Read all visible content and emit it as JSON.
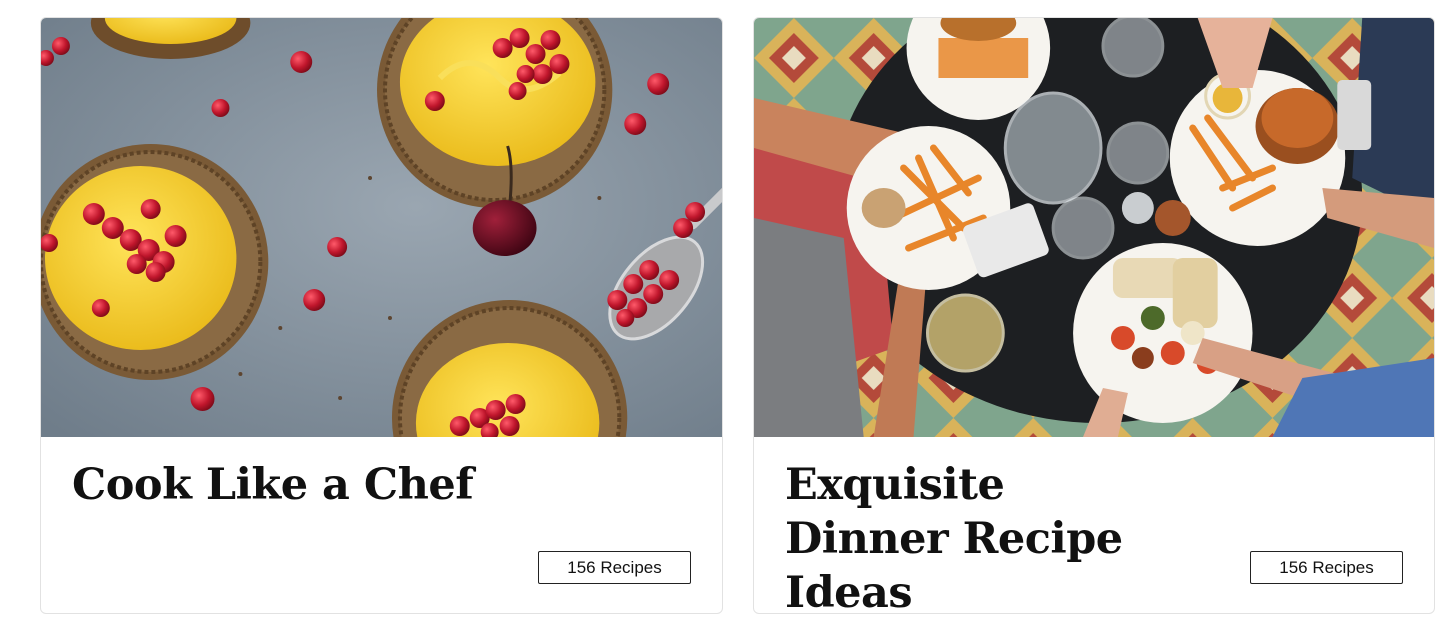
{
  "cards": [
    {
      "title": "Cook Like a Chef",
      "badge": "156 Recipes",
      "image_subject": "lemon-curd-tarts-with-red-currants"
    },
    {
      "title": "Exquisite Dinner Recipe Ideas",
      "badge": "156 Recipes",
      "image_subject": "overhead-dinner-table-with-burgers-and-fries"
    }
  ],
  "colors": {
    "card_border": "#e2e2e2",
    "title_text": "#111111",
    "badge_border": "#222222",
    "tart_slate": "#7d8a96",
    "tart_curd": "#f3cd2d",
    "tart_crust": "#7a5a36",
    "currant_red": "#c0162c",
    "table_dark": "#1d1f22",
    "tile_green": "#6e9a82",
    "fries_orange": "#e8862a"
  }
}
